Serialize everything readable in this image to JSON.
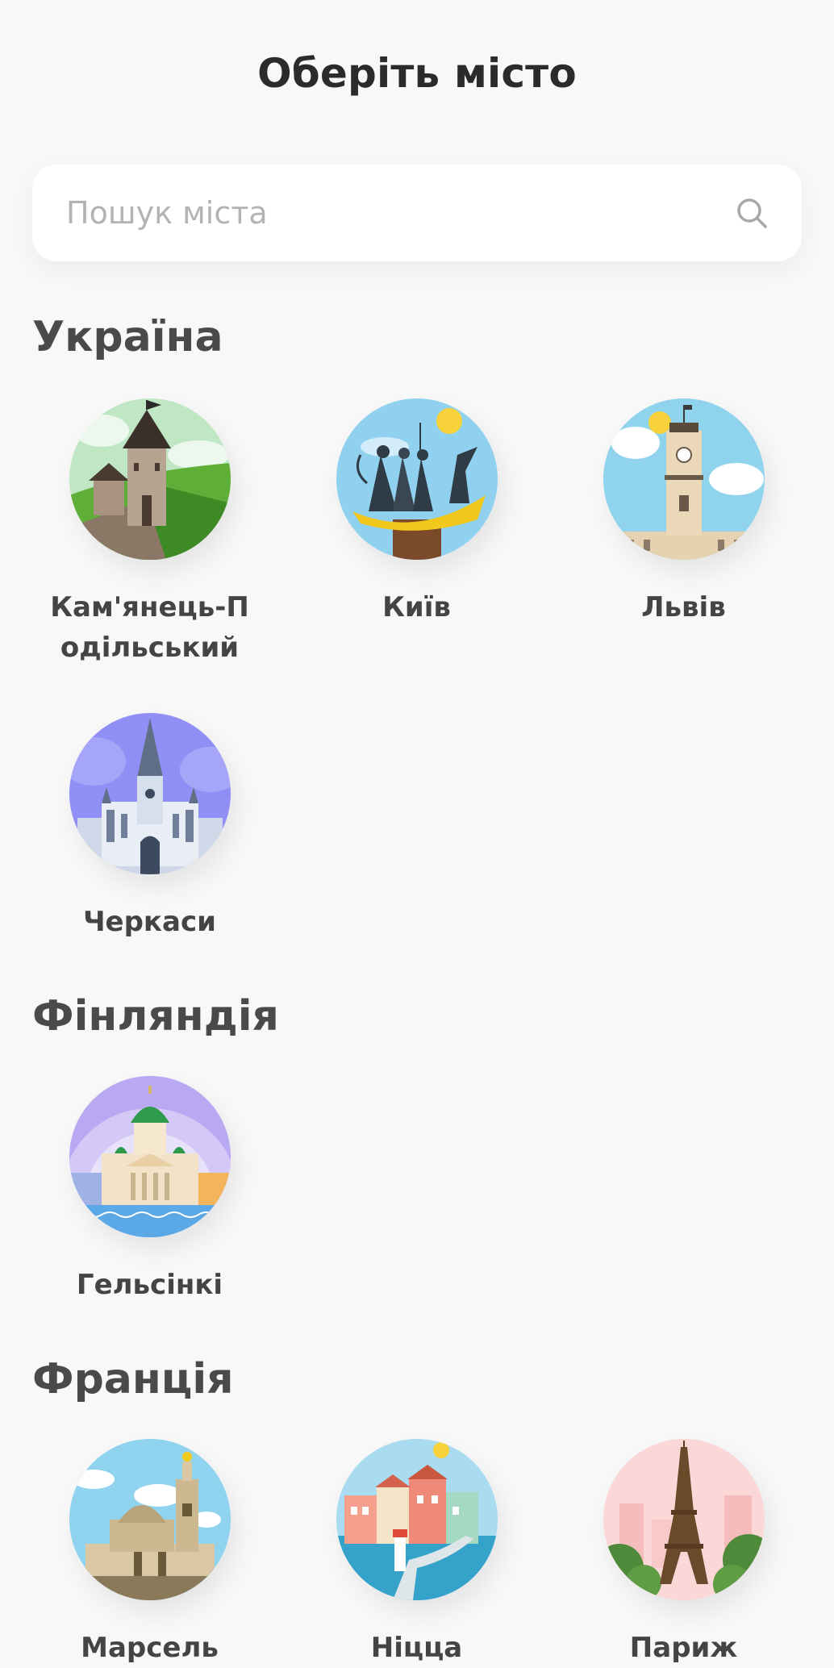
{
  "header": {
    "title": "Оберіть місто"
  },
  "search": {
    "placeholder": "Пошук міста",
    "icon": "search-icon"
  },
  "sections": [
    {
      "country": "Україна",
      "cities": [
        {
          "name": "Кам'янець-Подільський",
          "icon": "kamianets-castle-icon"
        },
        {
          "name": "Київ",
          "icon": "kyiv-founders-monument-icon"
        },
        {
          "name": "Львів",
          "icon": "lviv-town-hall-icon"
        },
        {
          "name": "Черкаси",
          "icon": "cherkasy-cathedral-icon"
        }
      ]
    },
    {
      "country": "Фінляндія",
      "cities": [
        {
          "name": "Гельсінкі",
          "icon": "helsinki-cathedral-icon"
        }
      ]
    },
    {
      "country": "Франція",
      "cities": [
        {
          "name": "Марсель",
          "icon": "marseille-basilica-icon"
        },
        {
          "name": "Ніцца",
          "icon": "nice-harbour-icon"
        },
        {
          "name": "Париж",
          "icon": "eiffel-tower-icon"
        }
      ]
    }
  ],
  "colors": {
    "background": "#f8f8f8",
    "title": "#2b2b2b",
    "heading": "#4a4a4a",
    "placeholder": "#b3b3b3"
  }
}
